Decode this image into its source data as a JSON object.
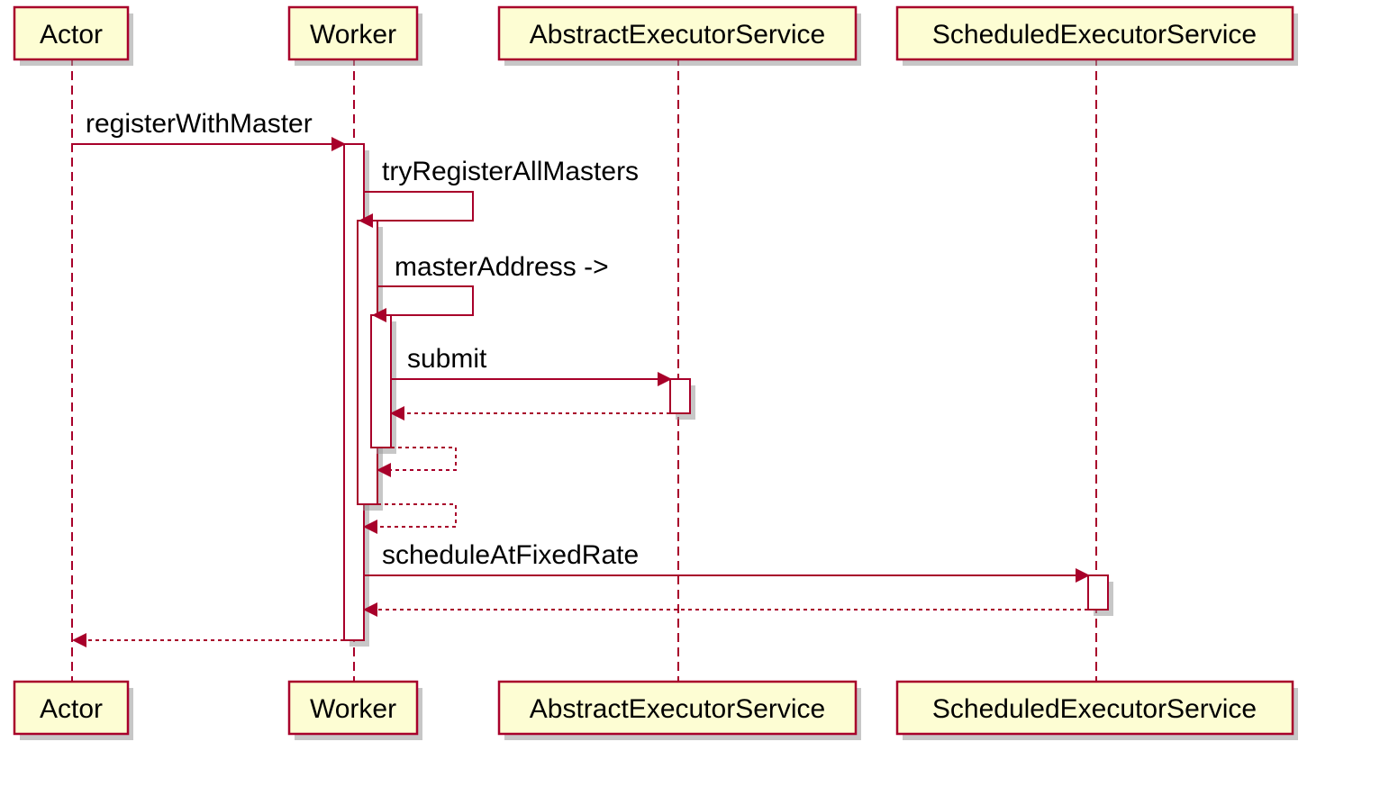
{
  "participants": {
    "actor": "Actor",
    "worker": "Worker",
    "abstractExecutor": "AbstractExecutorService",
    "scheduledExecutor": "ScheduledExecutorService"
  },
  "messages": {
    "registerWithMaster": "registerWithMaster",
    "tryRegisterAllMasters": "tryRegisterAllMasters",
    "masterAddress": "masterAddress ->",
    "submit": "submit",
    "scheduleAtFixedRate": "scheduleAtFixedRate"
  }
}
